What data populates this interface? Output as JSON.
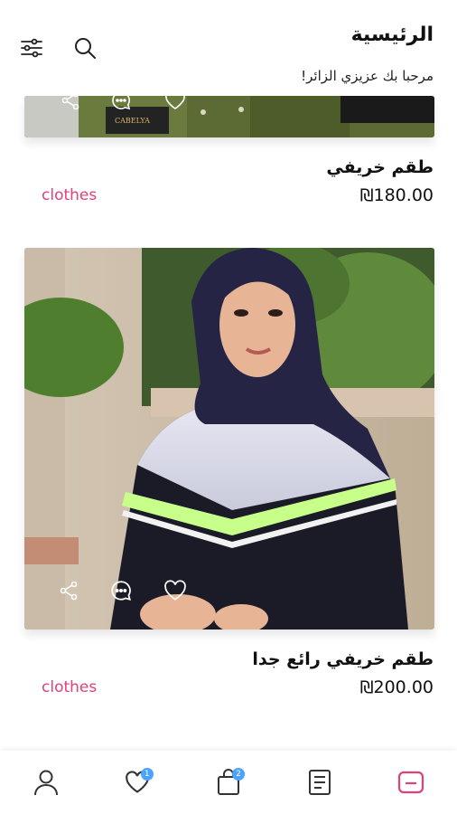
{
  "header": {
    "title": "الرئيسية",
    "subtitle": "مرحبا بك عزيزي الزائر!",
    "icons": [
      "filter-sliders-icon",
      "search-icon"
    ]
  },
  "products": [
    {
      "name": "طقم خريفي",
      "price": "₪180.00",
      "category": "clothes",
      "image": "photo of olive-green autumn outfit (cropped)"
    },
    {
      "name": "طقم خريفي رائع جدا",
      "price": "₪200.00",
      "category": "clothes",
      "image": "photo of woman in navy hijab with black and white top with neon stripe"
    }
  ],
  "card_actions": [
    "share-icon",
    "comment-icon",
    "heart-icon"
  ],
  "bottom_nav": {
    "items": [
      "profile-icon",
      "favorites-icon",
      "cart-icon",
      "orders-icon",
      "home-icon"
    ],
    "favorites_badge": "1",
    "cart_badge": "2",
    "active": "home-icon"
  },
  "colors": {
    "accent": "#e0407b",
    "badge": "#4aa3ff",
    "active_nav": "#e0407b"
  }
}
